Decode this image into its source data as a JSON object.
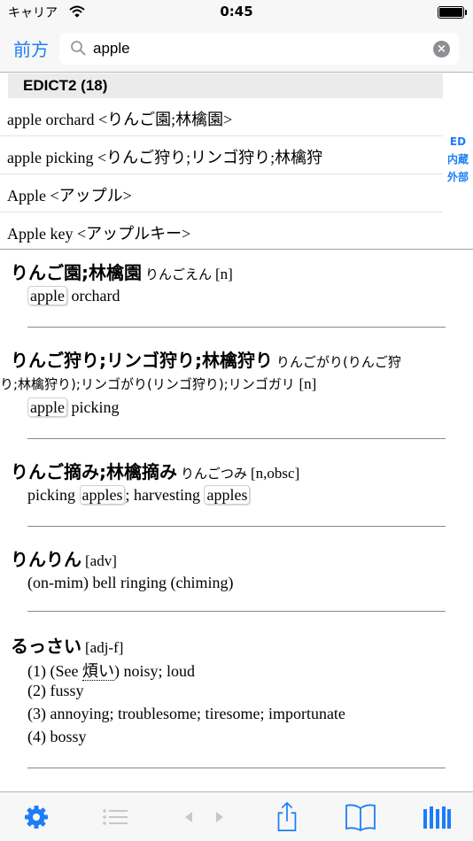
{
  "status": {
    "carrier": "キャリア",
    "time": "0:45"
  },
  "nav": {
    "back_label": "前方"
  },
  "search": {
    "value": "apple"
  },
  "results": {
    "header": "EDICT2 (18)",
    "items": [
      "apple orchard <りんご園;林檎園>",
      "apple picking <りんご狩り;リンゴ狩り;林檎狩",
      "Apple <アップル>",
      "Apple key <アップルキー>"
    ],
    "index": [
      "ED",
      "内蔵",
      "外部"
    ]
  },
  "entries": [
    {
      "headword": "りんご園;林檎園",
      "reading": "りんごえん",
      "tag": "[n]",
      "gloss": {
        "hl": "apple",
        "rest": " orchard"
      }
    },
    {
      "headword": "りんご狩り;リンゴ狩り;林檎狩り",
      "reading": "りんごがり(りんご狩",
      "cont": "り;林檎狩り);リンゴがり(リンゴ狩り);リンゴガリ",
      "tag": "[n]",
      "gloss": {
        "hl": "apple",
        "rest": " picking"
      }
    },
    {
      "headword": "りんご摘み;林檎摘み",
      "reading": "りんごつみ",
      "tag": "[n,obsc]",
      "gloss": {
        "a": "picking ",
        "hl1": "apples",
        "b": "; harvesting ",
        "hl2": "apples"
      }
    },
    {
      "headword": "りんりん",
      "tag": "[adv]",
      "gloss": "(on-mim) bell ringing (chiming)"
    },
    {
      "headword": "るっさい",
      "tag": "[adj-f]",
      "senses": {
        "s1_pre": "(1) (See ",
        "s1_ref": "煩い",
        "s1_post": ") noisy; loud",
        "s2": "(2) fussy",
        "s3": "(3) annoying; troublesome; tiresome; importunate",
        "s4": "(4) bossy"
      }
    }
  ],
  "colors": {
    "accent": "#1c7ef6",
    "bar_bg": "#f7f7f7",
    "inactive": "#c7c7cc"
  },
  "toolbar": {
    "icons": [
      "gear-icon",
      "list-icon",
      "prev-icon",
      "next-icon",
      "share-icon",
      "book-icon",
      "library-icon"
    ]
  }
}
